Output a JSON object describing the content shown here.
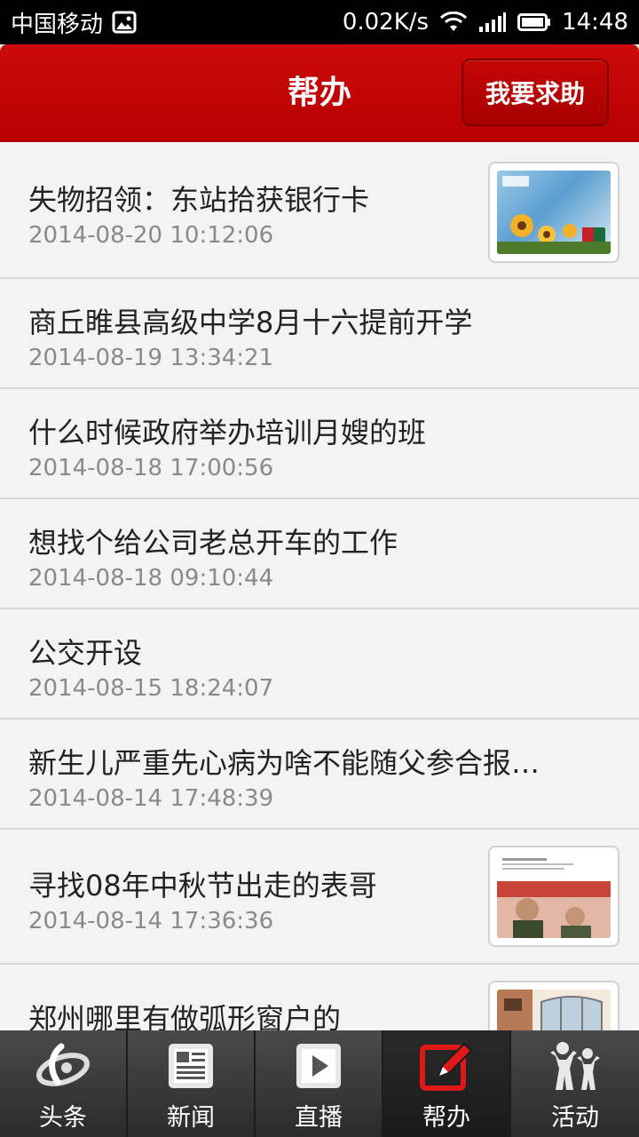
{
  "status_bar": {
    "carrier": "中国移动",
    "speed": "0.02K/s",
    "time": "14:48"
  },
  "header": {
    "title": "帮办",
    "help_button": "我要求助"
  },
  "items": [
    {
      "title": "失物招领：东站拾获银行卡",
      "time": "2014-08-20 10:12:06",
      "thumb": "bank-card"
    },
    {
      "title": "商丘睢县高级中学8月十六提前开学",
      "time": "2014-08-19 13:34:21"
    },
    {
      "title": "什么时候政府举办培训月嫂的班",
      "time": "2014-08-18 17:00:56"
    },
    {
      "title": "想找个给公司老总开车的工作",
      "time": "2014-08-18 09:10:44"
    },
    {
      "title": "公交开设",
      "time": "2014-08-15 18:24:07"
    },
    {
      "title": "新生儿严重先心病为啥不能随父参合报…",
      "time": "2014-08-14 17:48:39"
    },
    {
      "title": "寻找08年中秋节出走的表哥",
      "time": "2014-08-14 17:36:36",
      "thumb": "missing-person-poster"
    },
    {
      "title": "郑州哪里有做弧形窗户的",
      "time": "",
      "thumb": "building-window"
    }
  ],
  "bottom_nav": [
    {
      "label": "头条",
      "icon": "headline-logo-icon"
    },
    {
      "label": "新闻",
      "icon": "newspaper-icon"
    },
    {
      "label": "直播",
      "icon": "play-icon"
    },
    {
      "label": "帮办",
      "icon": "edit-icon",
      "active": true
    },
    {
      "label": "活动",
      "icon": "people-icon"
    }
  ],
  "colors": {
    "header_red": "#c00000",
    "active_icon": "#e01818"
  }
}
